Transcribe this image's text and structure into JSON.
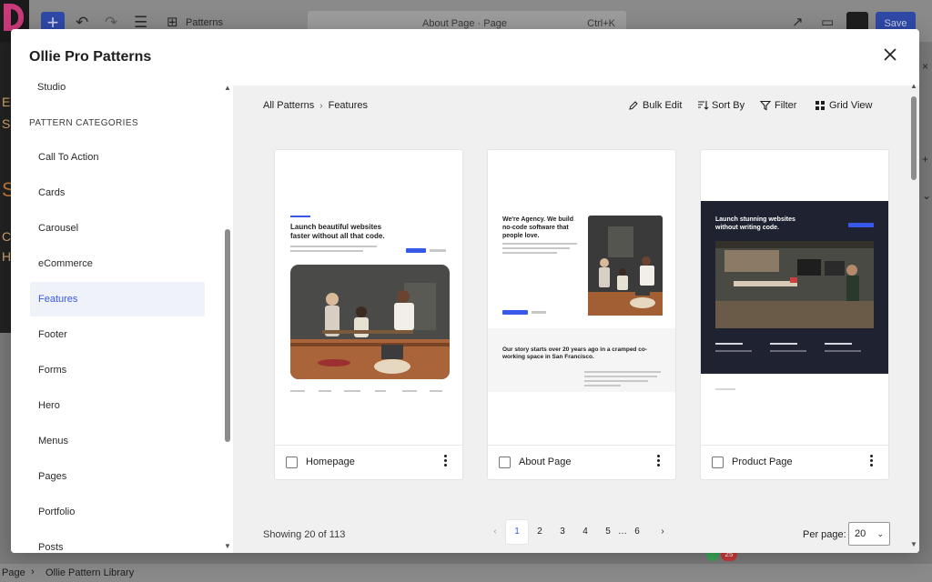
{
  "editor": {
    "patterns_label": "Patterns",
    "search_label": "About Page · Page",
    "search_shortcut": "Ctrl+K",
    "save_label": "Save",
    "bottom_breadcrumb": [
      "Page",
      "Ollie Pattern Library"
    ],
    "badge_count": "25",
    "side_letters": [
      "E",
      "S",
      "S",
      "C",
      "H"
    ]
  },
  "modal": {
    "title": "Ollie Pro Patterns",
    "close_icon": "close-icon"
  },
  "sidebar": {
    "partial_item": "Studio",
    "heading": "PATTERN CATEGORIES",
    "items": [
      {
        "label": "Call To Action",
        "active": false
      },
      {
        "label": "Cards",
        "active": false
      },
      {
        "label": "Carousel",
        "active": false
      },
      {
        "label": "eCommerce",
        "active": false
      },
      {
        "label": "Features",
        "active": true
      },
      {
        "label": "Footer",
        "active": false
      },
      {
        "label": "Forms",
        "active": false
      },
      {
        "label": "Hero",
        "active": false
      },
      {
        "label": "Menus",
        "active": false
      },
      {
        "label": "Pages",
        "active": false
      },
      {
        "label": "Portfolio",
        "active": false
      },
      {
        "label": "Posts",
        "active": false
      }
    ]
  },
  "main": {
    "breadcrumb": [
      "All Patterns",
      "Features"
    ],
    "actions": {
      "bulk_edit": "Bulk Edit",
      "sort_by": "Sort By",
      "filter": "Filter",
      "grid_view": "Grid View"
    },
    "cards": [
      {
        "title": "Homepage",
        "preview_heading": "Launch beautiful websites faster without all that code."
      },
      {
        "title": "About Page",
        "preview_heading": "We're Agency. We build no-code software that people love.",
        "preview_subheading": "Our story starts over 20 years ago in a cramped co-working space in San Francisco."
      },
      {
        "title": "Product Page",
        "preview_heading": "Launch stunning websites without writing code."
      }
    ],
    "showing": "Showing 20 of 113",
    "pagination": {
      "pages": [
        "1",
        "2",
        "3",
        "4",
        "5",
        "…",
        "6"
      ],
      "current": "1"
    },
    "per_page_label": "Per page:",
    "per_page_value": "20"
  },
  "colors": {
    "accent": "#3858e9",
    "active_bg": "#f0f2fa",
    "main_bg": "#f0f0f0"
  }
}
